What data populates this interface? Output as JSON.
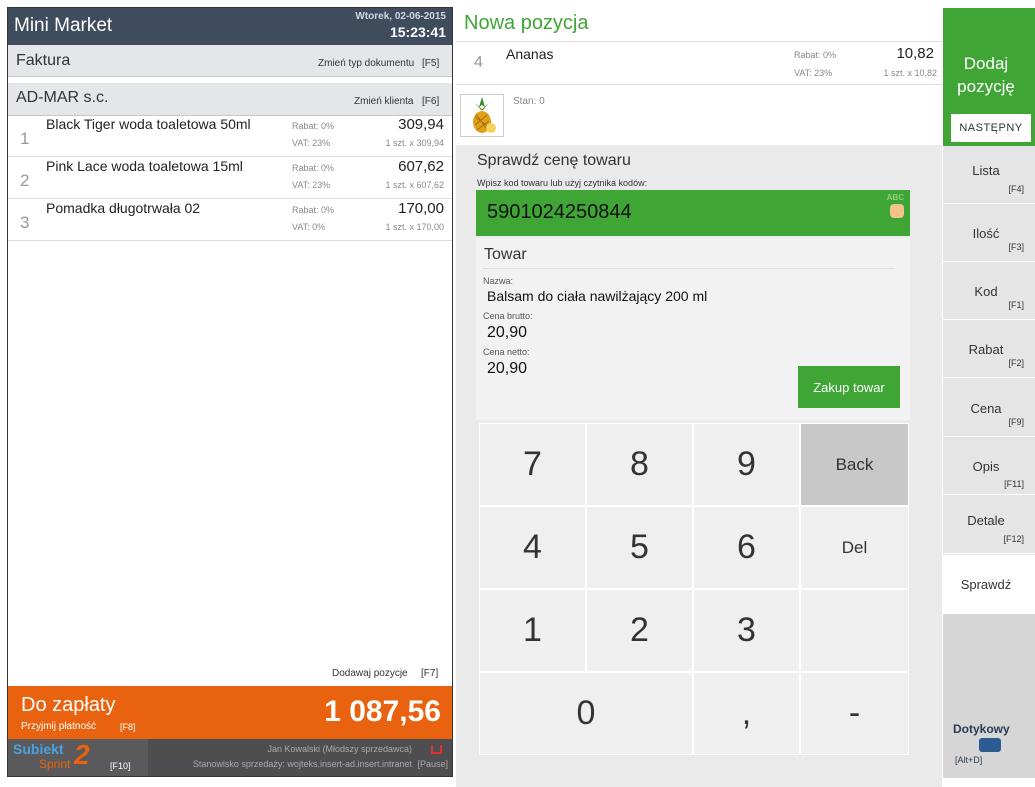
{
  "left": {
    "app_title": "Mini Market",
    "date": "Wtorek, 02-06-2015",
    "time": "15:23:41",
    "doc_type": "Faktura",
    "change_doc": "Zmień typ dokumentu",
    "change_doc_key": "[F5]",
    "client": "AD-MAR s.c.",
    "change_client": "Zmień klienta",
    "change_client_key": "[F6]",
    "items": [
      {
        "no": "1",
        "name": "Black Tiger woda toaletowa 50ml",
        "rabat": "Rabat: 0%",
        "vat": "VAT: 23%",
        "price": "309,94",
        "qty": "1 szt. x 309,94"
      },
      {
        "no": "2",
        "name": "Pink Lace woda toaletowa 15ml",
        "rabat": "Rabat: 0%",
        "vat": "VAT: 23%",
        "price": "607,62",
        "qty": "1 szt. x 607,62"
      },
      {
        "no": "3",
        "name": "Pomadka długotrwała 02",
        "rabat": "Rabat: 0%",
        "vat": "VAT: 0%",
        "price": "170,00",
        "qty": "1 szt. x 170,00"
      }
    ],
    "add_items": "Dodawaj pozycje",
    "add_items_key": "[F7]",
    "pay_label": "Do zapłaty",
    "pay_sub": "Przyjmij płatność",
    "pay_sub_key": "[F8]",
    "pay_total": "1 087,56",
    "logo_main": "Subiekt",
    "logo_sub": "Sprint",
    "logo_num": "2",
    "logo_key": "[F10]",
    "user": "Jan Kowalski (Młodszy sprzedawca)",
    "station": "Stanowisko sprzedaży: wojteks.insert-ad.insert.intranet",
    "pause_key": "[Pause]"
  },
  "middle": {
    "title": "Nowa pozycja",
    "item_no": "4",
    "item_name": "Ananas",
    "rabat": "Rabat: 0%",
    "vat": "VAT: 23%",
    "price": "10,82",
    "qty": "1 szt. x 10,82",
    "stan": "Stan: 0",
    "check_title": "Sprawdź cenę towaru",
    "scan_hint": "Wpisz kod towaru lub użyj czytnika kodów:",
    "barcode": "5901024250844",
    "abc": "ABC",
    "towar_title": "Towar",
    "name_label": "Nazwa:",
    "name_value": "Balsam do ciała nawilżający 200 ml",
    "gross_label": "Cena brutto:",
    "gross_value": "20,90",
    "net_label": "Cena netto:",
    "net_value": "20,90",
    "buy_button": "Zakup towar",
    "keys": {
      "k7": "7",
      "k8": "8",
      "k9": "9",
      "back": "Back",
      "k4": "4",
      "k5": "5",
      "k6": "6",
      "del": "Del",
      "k1": "1",
      "k2": "2",
      "k3": "3",
      "k0": "0",
      "comma": ",",
      "minus": "-"
    }
  },
  "right": {
    "add_line1": "Dodaj",
    "add_line2": "pozycję",
    "next": "NASTĘPNY",
    "buttons": [
      {
        "label": "Lista",
        "key": "[F4]"
      },
      {
        "label": "Ilość",
        "key": "[F3]"
      },
      {
        "label": "Kod",
        "key": "[F1]"
      },
      {
        "label": "Rabat",
        "key": "[F2]"
      },
      {
        "label": "Cena",
        "key": "[F9]"
      },
      {
        "label": "Opis",
        "key": "[F11]"
      },
      {
        "label": "Detale",
        "key": "[F12]"
      }
    ],
    "check": "Sprawdź",
    "touch": "Dotykowy",
    "touch_key": "[Alt+D]"
  },
  "colors": {
    "accent_green": "#3fa535",
    "orange": "#e8620f",
    "header": "#3e4c5e"
  }
}
